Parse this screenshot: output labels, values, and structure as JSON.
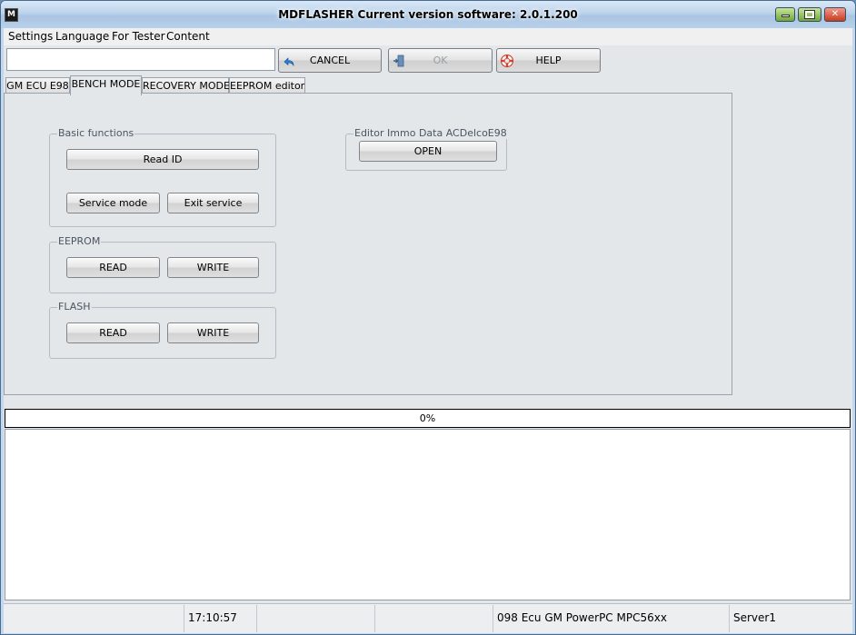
{
  "window": {
    "app_icon_text": "M",
    "title": "MDFLASHER  Current version software: 2.0.1.200"
  },
  "menu": {
    "items": [
      "Settings",
      "Language",
      "For Tester",
      "Content"
    ]
  },
  "toolbar": {
    "input_value": "",
    "cancel_label": "CANCEL",
    "ok_label": "OK",
    "help_label": "HELP",
    "ok_enabled": false
  },
  "tabs": [
    {
      "label": "GM ECU E98",
      "active": false
    },
    {
      "label": "BENCH MODE",
      "active": true
    },
    {
      "label": "RECOVERY MODE",
      "active": false
    },
    {
      "label": "EEPROM editor",
      "active": false
    }
  ],
  "bench": {
    "basic_functions": {
      "title": "Basic functions",
      "read_id_label": "Read ID",
      "service_mode_label": "Service mode",
      "exit_service_label": "Exit service"
    },
    "eeprom": {
      "title": "EEPROM",
      "read_label": "READ",
      "write_label": "WRITE"
    },
    "flash": {
      "title": "FLASH",
      "read_label": "READ",
      "write_label": "WRITE"
    },
    "immo_editor": {
      "title": "Editor Immo Data ACDelcoE98",
      "open_label": "OPEN"
    }
  },
  "progress": {
    "value": 0,
    "text": "0%"
  },
  "log": {
    "lines": []
  },
  "status": {
    "panel1": "",
    "time": "17:10:57",
    "panel3": "",
    "panel4": "",
    "ecu": "098 Ecu GM PowerPC MPC56xx",
    "server": "Server1"
  },
  "colors": {
    "titlebar": "#bcd3ea",
    "progress_fill": "#3a8fd0",
    "close_button": "#c83a20",
    "min_max_button": "#6fa83a"
  }
}
